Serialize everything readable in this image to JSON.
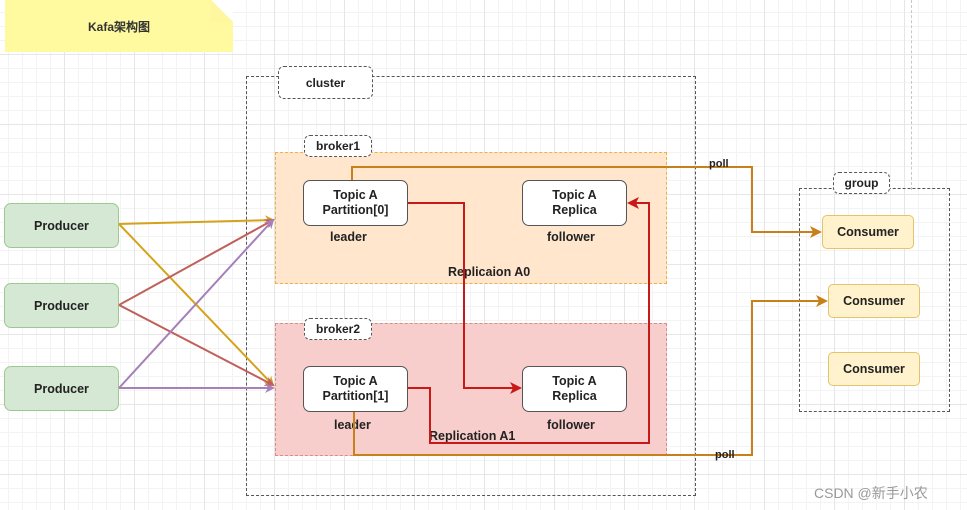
{
  "title_note": "Kafa架构图",
  "cluster": {
    "label": "cluster"
  },
  "brokers": [
    {
      "label": "broker1",
      "leader": {
        "line1": "Topic A",
        "line2": "Partition[0]",
        "role": "leader"
      },
      "follower": {
        "line1": "Topic A",
        "line2": "Replica",
        "role": "follower"
      },
      "replication_label": "Replicaion A0"
    },
    {
      "label": "broker2",
      "leader": {
        "line1": "Topic A",
        "line2": "Partition[1]",
        "role": "leader"
      },
      "follower": {
        "line1": "Topic A",
        "line2": "Replica",
        "role": "follower"
      },
      "replication_label": "Replication A1"
    }
  ],
  "producers": [
    "Producer",
    "Producer",
    "Producer"
  ],
  "group": {
    "label": "group",
    "consumers": [
      "Consumer",
      "Consumer",
      "Consumer"
    ]
  },
  "edges": {
    "poll_top": "poll",
    "poll_bottom": "poll"
  },
  "colors": {
    "producer1_edge": "#d6a21a",
    "producer2_edge": "#c0605a",
    "producer3_edge": "#a680b8",
    "replication_edge": "#c81818",
    "poll_edge": "#c8801a"
  },
  "watermark": "CSDN @新手小农"
}
